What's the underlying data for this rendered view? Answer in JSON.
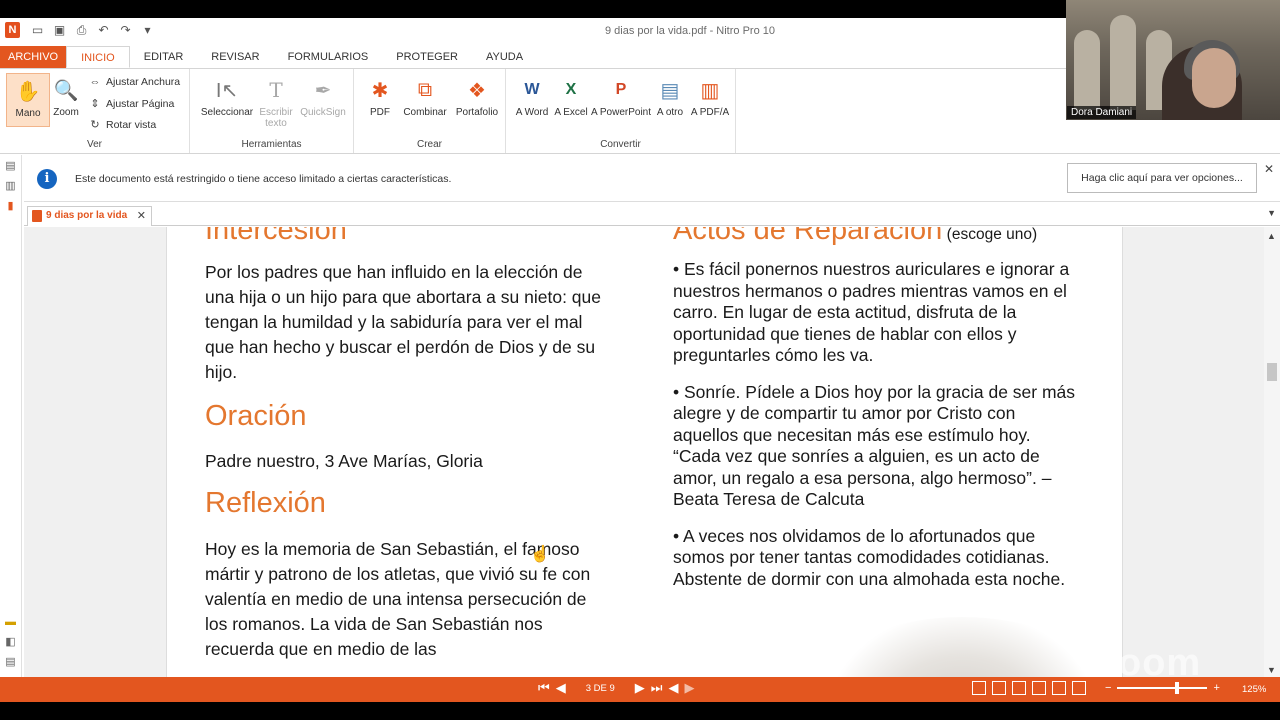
{
  "window": {
    "title": "9 dias por la vida.pdf - Nitro Pro 10",
    "logo": "N"
  },
  "tabs": [
    "ARCHIVO",
    "INICIO",
    "EDITAR",
    "REVISAR",
    "FORMULARIOS",
    "PROTEGER",
    "AYUDA"
  ],
  "ribbon": {
    "ver": {
      "label": "Ver",
      "mano": "Mano",
      "zoom": "Zoom",
      "ajustar_anchura": "Ajustar Anchura",
      "ajustar_pagina": "Ajustar Página",
      "rotar_vista": "Rotar vista"
    },
    "herramientas": {
      "label": "Herramientas",
      "seleccionar": "Seleccionar",
      "escribir_texto": "Escribir texto",
      "quicksign": "QuickSign"
    },
    "crear": {
      "label": "Crear",
      "pdf": "PDF",
      "combinar": "Combinar",
      "portafolio": "Portafolio"
    },
    "convertir": {
      "label": "Convertir",
      "a_word": "A Word",
      "a_excel": "A Excel",
      "a_powerpoint": "A PowerPoint",
      "a_otro": "A otro",
      "a_pdfa": "A PDF/A"
    }
  },
  "notice": {
    "message": "Este documento está restringido o tiene acceso limitado a ciertas características.",
    "button": "Haga clic aquí para ver opciones..."
  },
  "doc_tab": {
    "label": "9 dias por la vida"
  },
  "document": {
    "left": {
      "heading1": "Intercesión",
      "para1": "Por los padres que han influido en la elección de una hija o un hijo para que abortara a su nieto: que tengan la humildad y la sabiduría para ver el mal que han hecho y buscar el perdón de Dios y de su hijo.",
      "heading2": "Oración",
      "para2": "Padre nuestro, 3 Ave Marías, Gloria",
      "heading3": "Reflexión",
      "para3": "Hoy es la memoria de San Sebastián, el famoso mártir y patrono de los atletas, que vivió su fe con valentía en medio de una intensa persecución de los romanos. La vida de San Sebastián nos recuerda que en medio de las"
    },
    "right": {
      "heading": "Actos de Reparación",
      "heading_sub": "(escoge uno)",
      "bullet1": "• Es fácil ponernos nuestros auriculares e ignorar a nuestros hermanos o padres mientras vamos en el carro. En lugar de esta actitud, disfruta de la oportunidad que tienes de hablar con ellos y preguntarles cómo les va.",
      "bullet2": "• Sonríe. Pídele a Dios hoy por la gracia de ser más alegre y de compartir tu amor por Cristo con aquellos que necesitan más ese estímulo hoy. “Cada vez que sonríes a alguien, es un acto de amor, un regalo a esa persona, algo hermoso”. –Beata Teresa de Calcuta",
      "bullet3": "• A veces nos olvidamos de lo afortunados que somos por tener tantas comodidades cotidianas. Abstente de dormir con una almohada esta noche."
    }
  },
  "status": {
    "page_indicator": "3 DE 9",
    "zoom": "125%",
    "zoom_level_fraction": 0.64
  },
  "video": {
    "participant": "Dora Damiani",
    "watermark": "zoom"
  },
  "colors": {
    "accent": "#e3561f",
    "heading": "#e4772f"
  }
}
